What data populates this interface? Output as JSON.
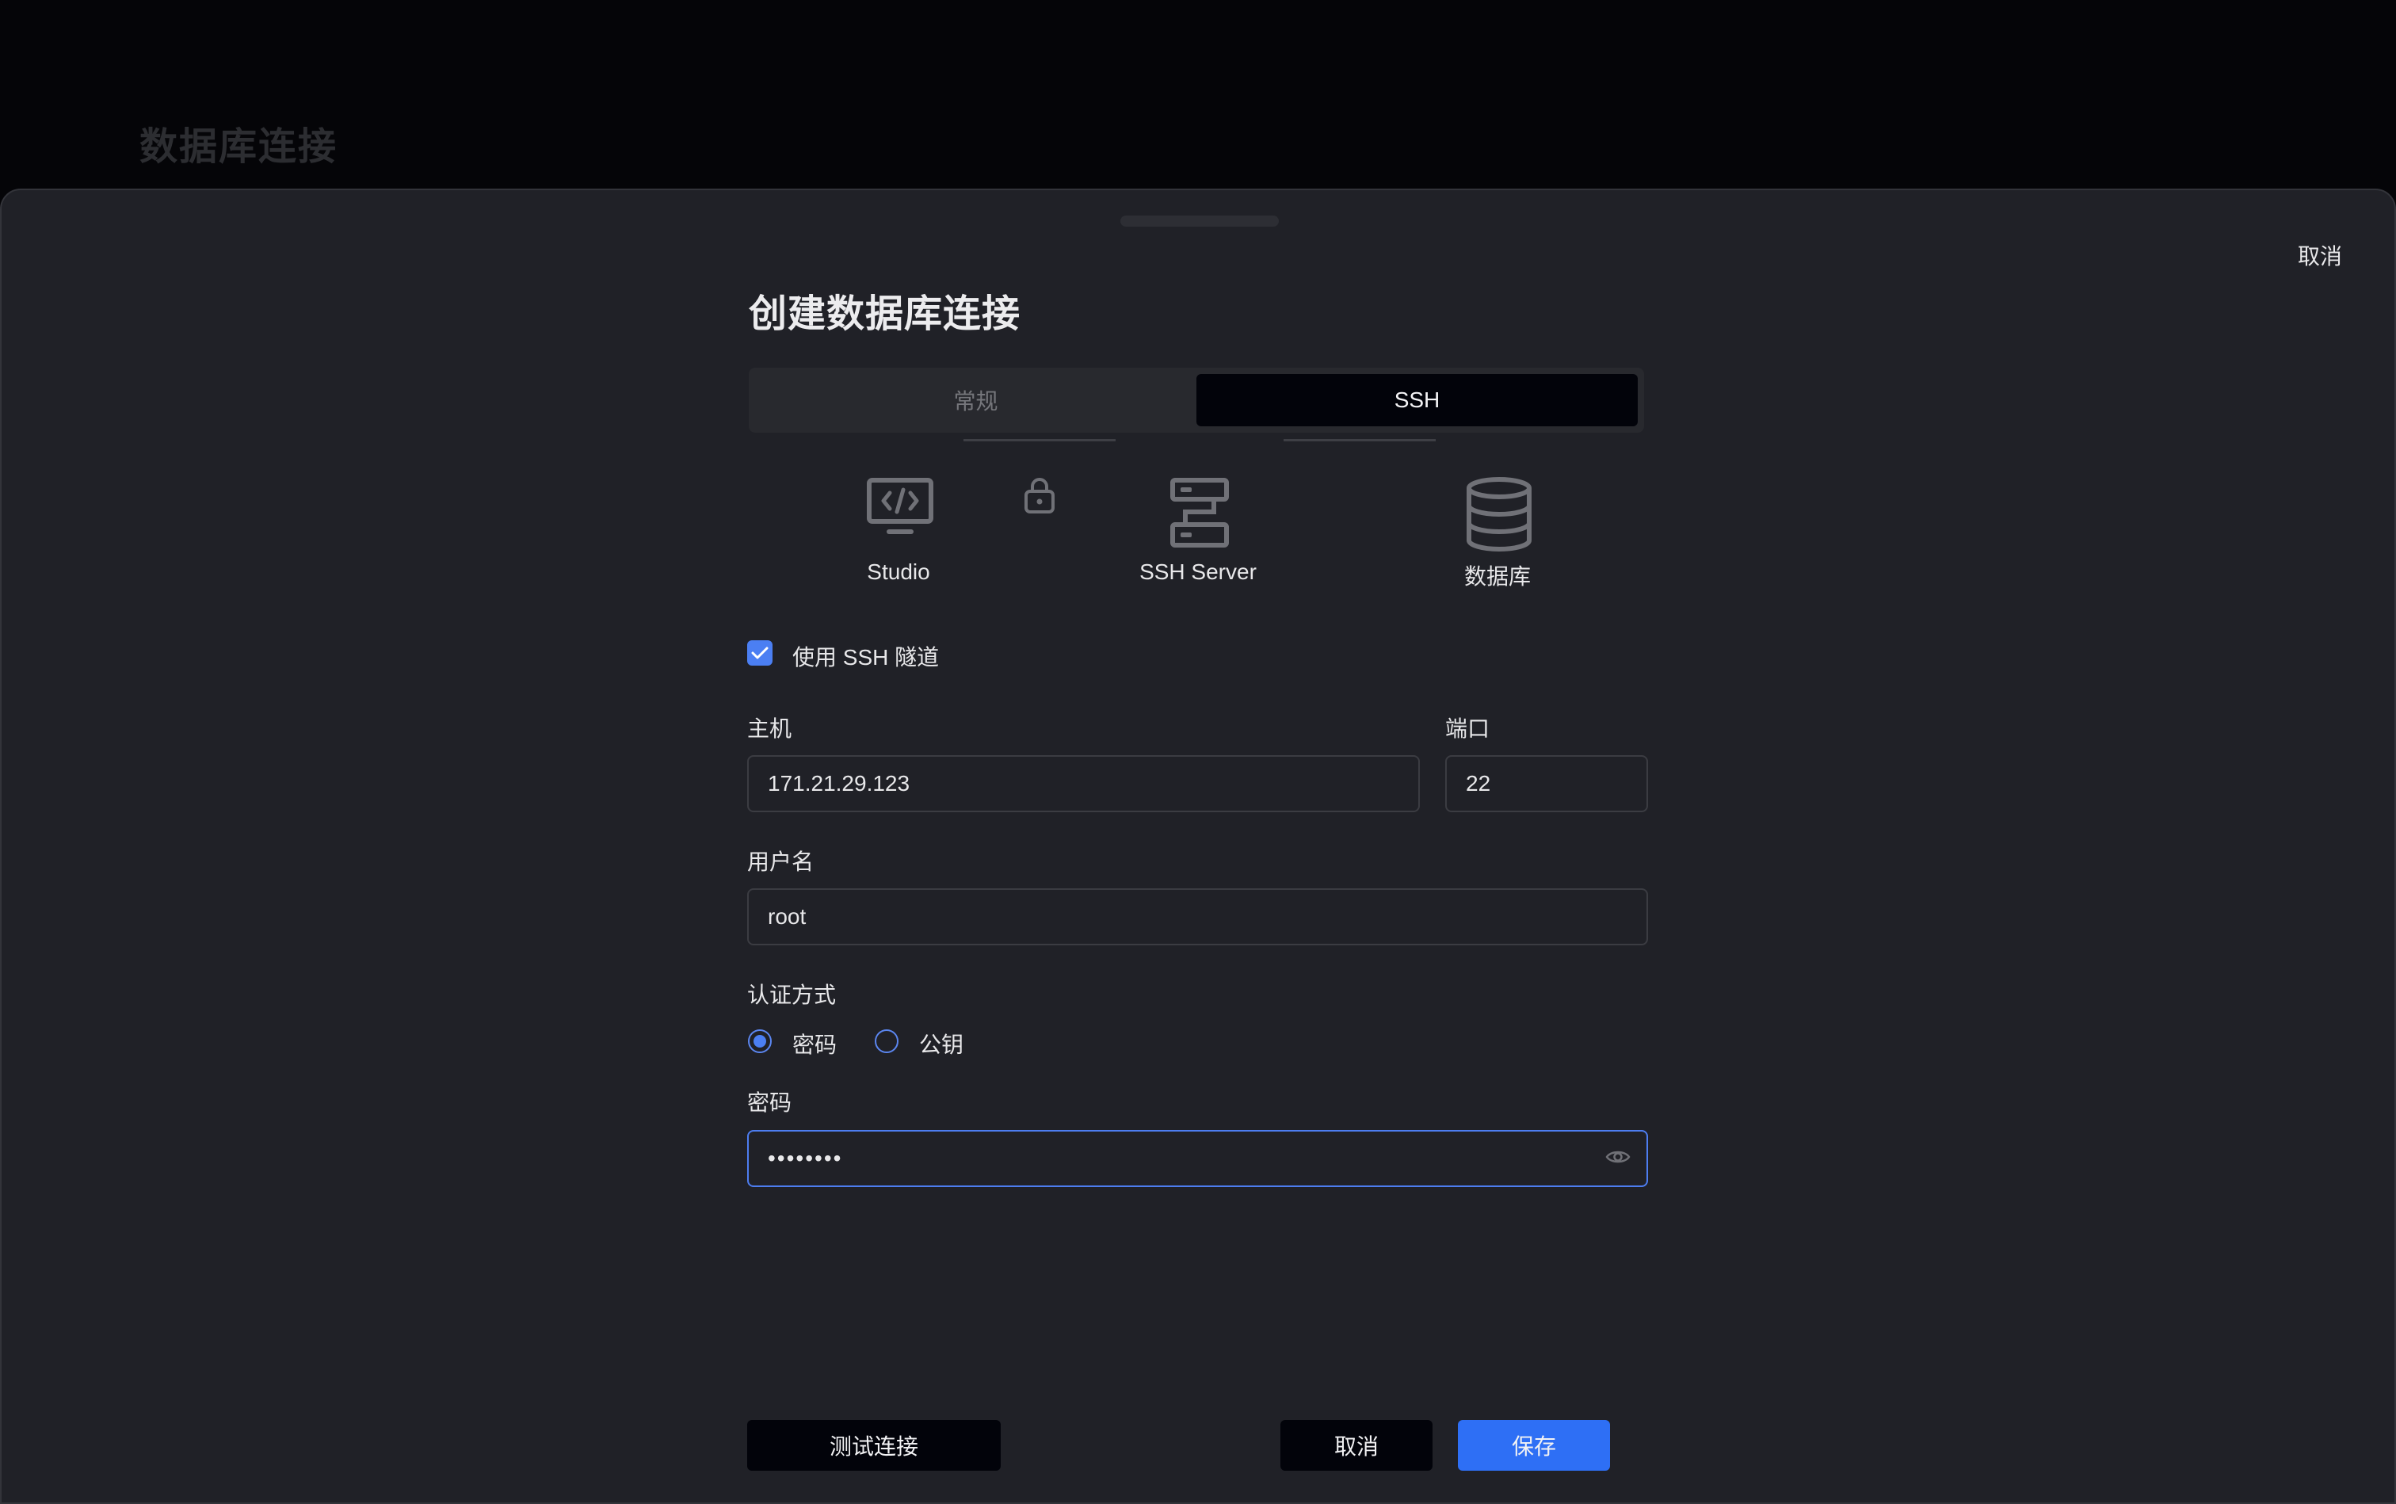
{
  "background": {
    "title": "数据库连接"
  },
  "sheet": {
    "top_cancel": "取消",
    "title": "创建数据库连接",
    "tabs": [
      {
        "label": "常规",
        "active": false
      },
      {
        "label": "SSH",
        "active": true
      }
    ],
    "diagram": {
      "nodes": [
        {
          "label": "Studio",
          "icon": "monitor-code-icon"
        },
        {
          "label": "SSH Server",
          "icon": "server-icon"
        },
        {
          "label": "数据库",
          "icon": "database-icon"
        }
      ],
      "link_icon": "lock-icon"
    },
    "use_ssh": {
      "label": "使用 SSH 隧道",
      "checked": true
    },
    "host": {
      "label": "主机",
      "value": "171.21.29.123"
    },
    "port": {
      "label": "端口",
      "value": "22"
    },
    "username": {
      "label": "用户名",
      "value": "root"
    },
    "auth": {
      "label": "认证方式",
      "options": [
        {
          "label": "密码",
          "selected": true
        },
        {
          "label": "公钥",
          "selected": false
        }
      ]
    },
    "password": {
      "label": "密码",
      "value": "••••••••",
      "toggle_icon": "eye-icon"
    },
    "buttons": {
      "test": "测试连接",
      "cancel": "取消",
      "save": "保存"
    }
  },
  "colors": {
    "accent": "#2e6ff5",
    "sheet_bg": "#202127",
    "page_bg": "#050508"
  }
}
